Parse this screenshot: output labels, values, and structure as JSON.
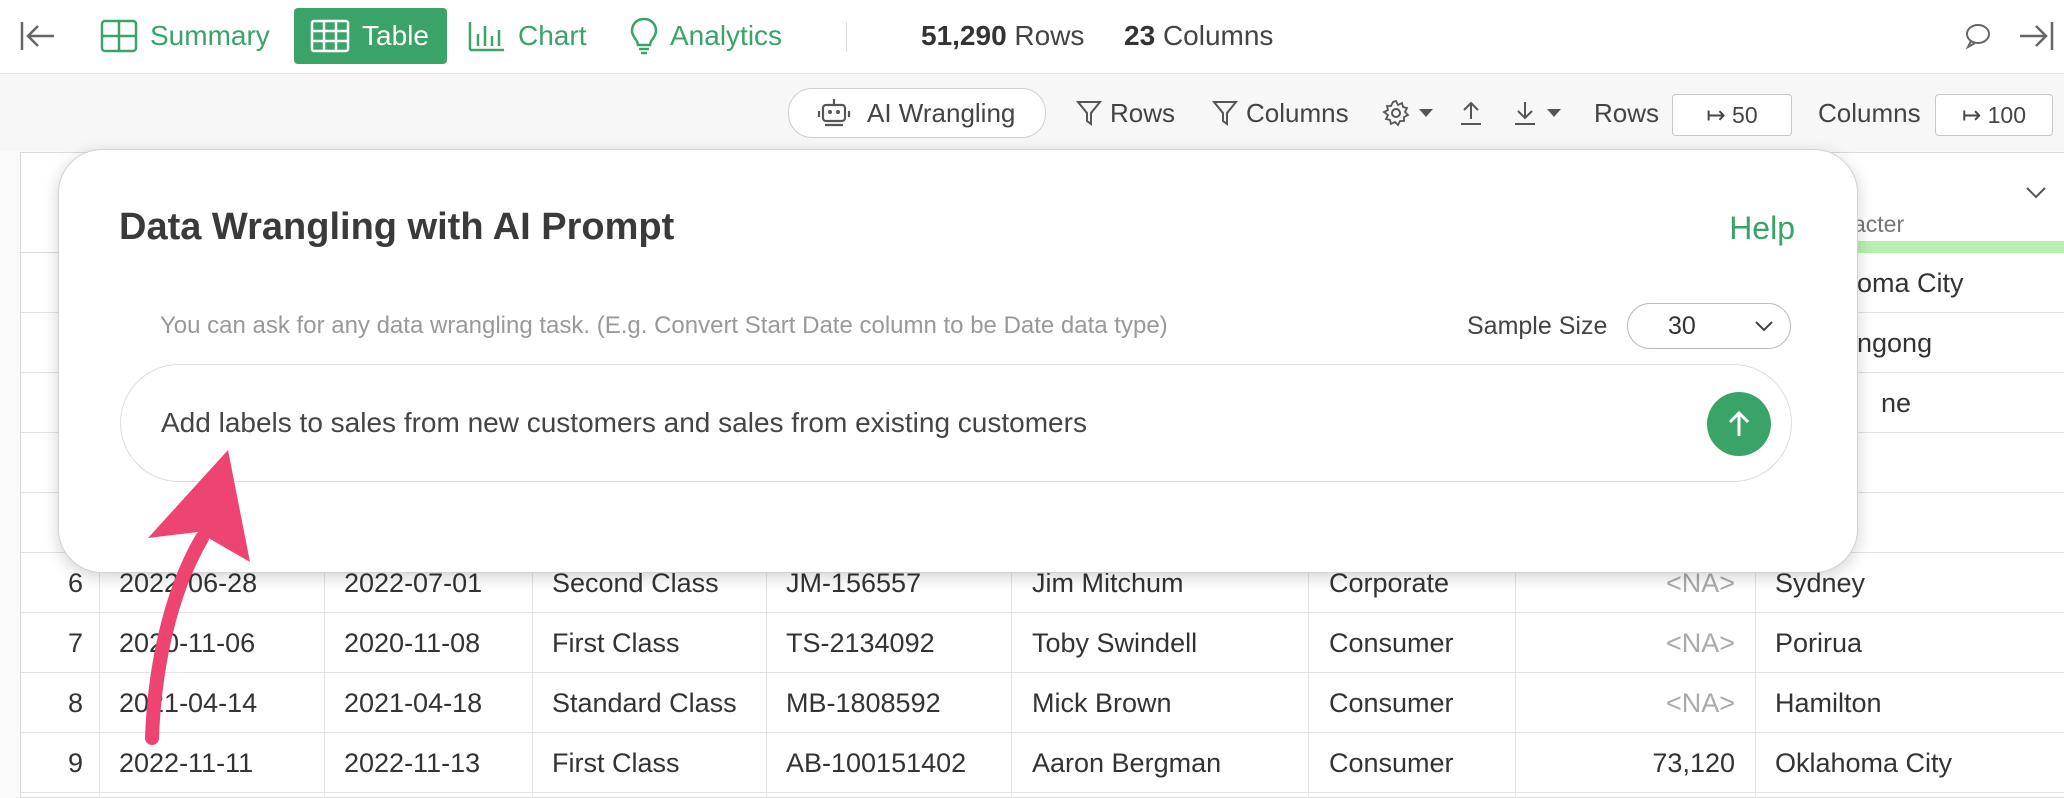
{
  "topbar": {
    "tabs": [
      {
        "label": "Summary",
        "icon": "summary-grid-icon"
      },
      {
        "label": "Table",
        "icon": "table-icon",
        "active": true
      },
      {
        "label": "Chart",
        "icon": "bar-chart-icon"
      },
      {
        "label": "Analytics",
        "icon": "lightbulb-icon"
      }
    ],
    "rows_count": "51,290",
    "rows_label": "Rows",
    "cols_count": "23",
    "cols_label": "Columns"
  },
  "toolbar": {
    "ai_label": "AI Wrangling",
    "rows_filter": "Rows",
    "cols_filter": "Columns",
    "rows_label": "Rows",
    "rows_value": "↦ 50",
    "cols_label": "Columns",
    "cols_value": "↦ 100"
  },
  "header": {
    "type_partial": "acter",
    "accent": "#b9f0b0"
  },
  "rows": [
    {
      "c8": "oma City"
    },
    {
      "c8": "ngong"
    },
    {
      "c8": "ne"
    },
    {
      "c8": ""
    },
    {
      "c8": ""
    },
    {
      "num": "6",
      "c1": "2022-06-28",
      "c2": "2022-07-01",
      "c3": "Second Class",
      "c4": "JM-156557",
      "c5": "Jim Mitchum",
      "c6": "Corporate",
      "c7": "<NA>",
      "c8": "Sydney"
    },
    {
      "num": "7",
      "c1": "2020-11-06",
      "c2": "2020-11-08",
      "c3": "First Class",
      "c4": "TS-2134092",
      "c5": "Toby Swindell",
      "c6": "Consumer",
      "c7": "<NA>",
      "c8": "Porirua"
    },
    {
      "num": "8",
      "c1": "2021-04-14",
      "c2": "2021-04-18",
      "c3": "Standard Class",
      "c4": "MB-1808592",
      "c5": "Mick Brown",
      "c6": "Consumer",
      "c7": "<NA>",
      "c8": "Hamilton"
    },
    {
      "num": "9",
      "c1": "2022-11-11",
      "c2": "2022-11-13",
      "c3": "First Class",
      "c4": "AB-100151402",
      "c5": "Aaron Bergman",
      "c6": "Consumer",
      "c7": "73,120",
      "c8": "Oklahoma City"
    }
  ],
  "modal": {
    "title": "Data Wrangling with AI Prompt",
    "help": "Help",
    "hint": "You can ask for any data wrangling task. (E.g. Convert Start Date column to be Date data type)",
    "sample_label": "Sample Size",
    "sample_value": "30",
    "prompt_text": "Add labels to sales from new customers and sales from existing customers"
  },
  "colors": {
    "brand": "#3aa468",
    "arrow": "#ee4472"
  }
}
